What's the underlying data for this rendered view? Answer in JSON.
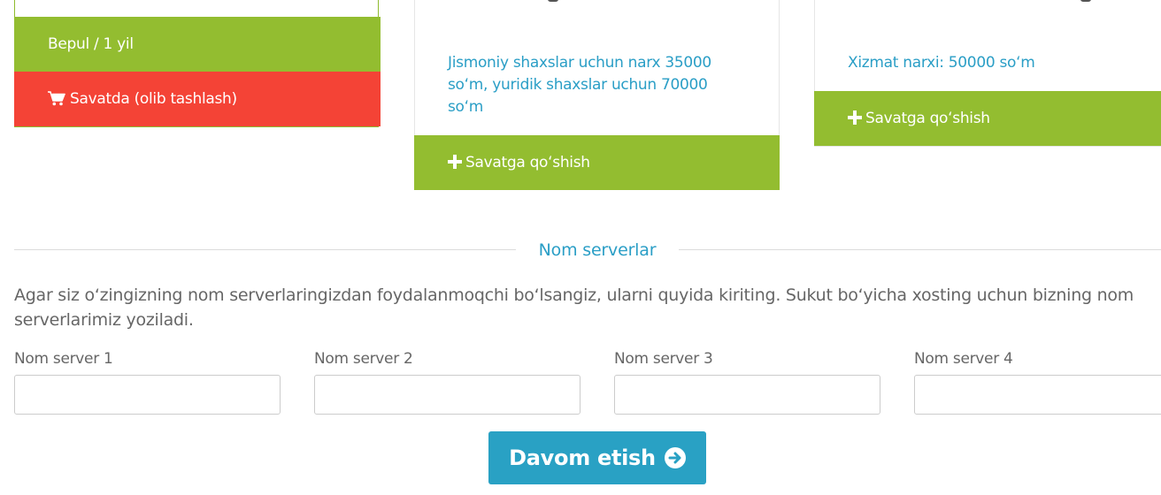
{
  "card_free": {
    "price_label": "Bepul / 1 yil",
    "remove_label": "Savatda (olib tashlash)",
    "remove_icon": "cart-icon"
  },
  "card_individual": {
    "description": "Jismoniy shaxslar uchun narx 35000 soʻm, yuridik shaxslar uchun 70000 soʻm",
    "add_label": "Savatga qoʻshish",
    "add_icon": "plus-icon"
  },
  "card_service": {
    "description": "Xizmat narxi: 50000 soʻm",
    "add_label": "Savatga qoʻshish",
    "add_icon": "plus-icon"
  },
  "nameservers": {
    "title": "Nom serverlar",
    "info": "Agar siz oʻzingizning nom serverlaringizdan foydalanmoqchi boʻlsangiz, ularni quyida kiriting. Sukut boʻyicha xosting uchun bizning nom serverlarimiz yoziladi.",
    "fields": [
      {
        "label": "Nom server 1",
        "value": ""
      },
      {
        "label": "Nom server 2",
        "value": ""
      },
      {
        "label": "Nom server 3",
        "value": ""
      },
      {
        "label": "Nom server 4",
        "value": ""
      }
    ]
  },
  "continue": {
    "label": "Davom etish",
    "icon": "arrow-circle-right-icon"
  },
  "colors": {
    "green": "#93bd30",
    "red": "#f44336",
    "blue": "#29a1c4",
    "link": "#2a9ec6"
  }
}
